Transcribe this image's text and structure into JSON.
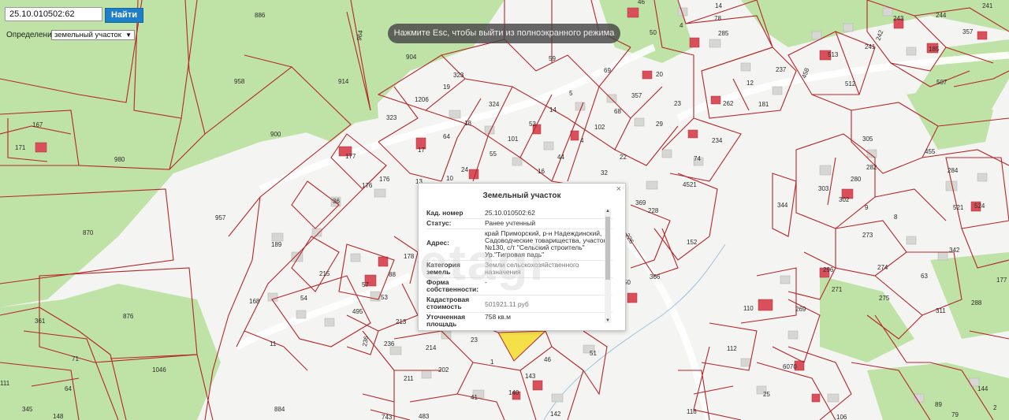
{
  "search": {
    "value": "25.10.010502:62",
    "button": "Найти"
  },
  "definition": {
    "label": "Определение:",
    "selected": "земельный участок"
  },
  "fullscreen_hint": "Нажмите Esc, чтобы выйти из полноэкранного режима",
  "popup": {
    "title": "Земельный участок",
    "close": "×",
    "rows": [
      {
        "key": "Кад. номер",
        "value": "25.10.010502:62"
      },
      {
        "key": "Статус:",
        "value": "Ранее учтенный"
      },
      {
        "key": "Адрес:",
        "value": "край Приморский, р-н Надеждинский, Садоводческие товарищества, участок №130, с/т \"Сельский строитель\" Ур.\"Тигровая падь\""
      },
      {
        "key": "Категория земель",
        "value": "Земли сельскохозяйственного назначения"
      },
      {
        "key": "Форма собственности:",
        "value": "-"
      },
      {
        "key": "Кадастровая стоимость",
        "value": "501921.11 руб"
      },
      {
        "key": "Уточненная площадь",
        "value": "758 кв.м"
      }
    ]
  },
  "watermark": "etagi",
  "colors": {
    "forest": "#bfe3a6",
    "empty": "#f4f4f2",
    "boundary": "#b4262a",
    "building": "#d8d8d4",
    "highlight": "#f5e04a",
    "roof_red": "#d9505a"
  },
  "map_labels": {
    "886": "886",
    "964": "964",
    "904": "904",
    "958": "958",
    "914": "914",
    "900": "900",
    "167": "167",
    "171": "171",
    "980": "980",
    "957": "957",
    "870": "870",
    "876": "876",
    "1046": "1046",
    "884": "884",
    "361": "361",
    "71": "71",
    "64": "64",
    "111": "111",
    "148": "148",
    "345": "345",
    "323a": "323",
    "1206": "1206",
    "323b": "323",
    "19": "19",
    "324": "324",
    "59": "59",
    "69": "69",
    "18": "18",
    "17": "17",
    "64b": "64",
    "53": "53",
    "101": "101",
    "55": "55",
    "24": "24",
    "10": "10",
    "13": "13",
    "177": "177",
    "176": "176",
    "176b": "176",
    "36": "36",
    "189": "189",
    "215": "215",
    "178": "178",
    "88": "88",
    "53b": "53",
    "57": "57",
    "168": "168",
    "54": "54",
    "495": "495",
    "11": "11",
    "213": "213",
    "236": "236",
    "236b": "236",
    "214": "214",
    "23b": "23",
    "202": "202",
    "211": "211",
    "1": "1",
    "46": "46",
    "143": "143",
    "140": "140",
    "41": "41",
    "483": "483",
    "743": "743",
    "142": "142",
    "51": "51",
    "4": "4",
    "44": "44",
    "16": "16",
    "14": "14",
    "5": "5",
    "102": "102",
    "68": "68",
    "22": "22",
    "32": "32",
    "357": "357",
    "20": "20",
    "29": "29",
    "23": "23",
    "50": "50",
    "285": "285",
    "78": "78",
    "14b": "14",
    "46b": "46",
    "4b": "4",
    "234": "234",
    "74": "74",
    "4521": "4521",
    "152": "152",
    "366": "366",
    "226": "226",
    "228": "228",
    "369": "369",
    "50b": "50",
    "243": "243",
    "244": "244",
    "242": "242",
    "357b": "357",
    "185": "185",
    "241": "241",
    "513": "513",
    "512": "512",
    "237": "237",
    "458": "458",
    "12": "12",
    "181": "181",
    "262": "262",
    "507": "507",
    "305": "305",
    "282": "282",
    "455": "455",
    "284": "284",
    "344": "344",
    "303": "303",
    "302": "302",
    "280": "280",
    "521": "521",
    "524": "524",
    "9": "9",
    "8": "8",
    "273": "273",
    "342": "342",
    "296": "296",
    "274": "274",
    "63": "63",
    "271": "271",
    "275": "275",
    "311": "311",
    "288": "288",
    "177b": "177",
    "110": "110",
    "269": "269",
    "112": "112",
    "6070": "6070",
    "25": "25",
    "116": "116",
    "106": "106",
    "144": "144",
    "89": "89",
    "79": "79",
    "2": "2",
    "241b": "241"
  }
}
